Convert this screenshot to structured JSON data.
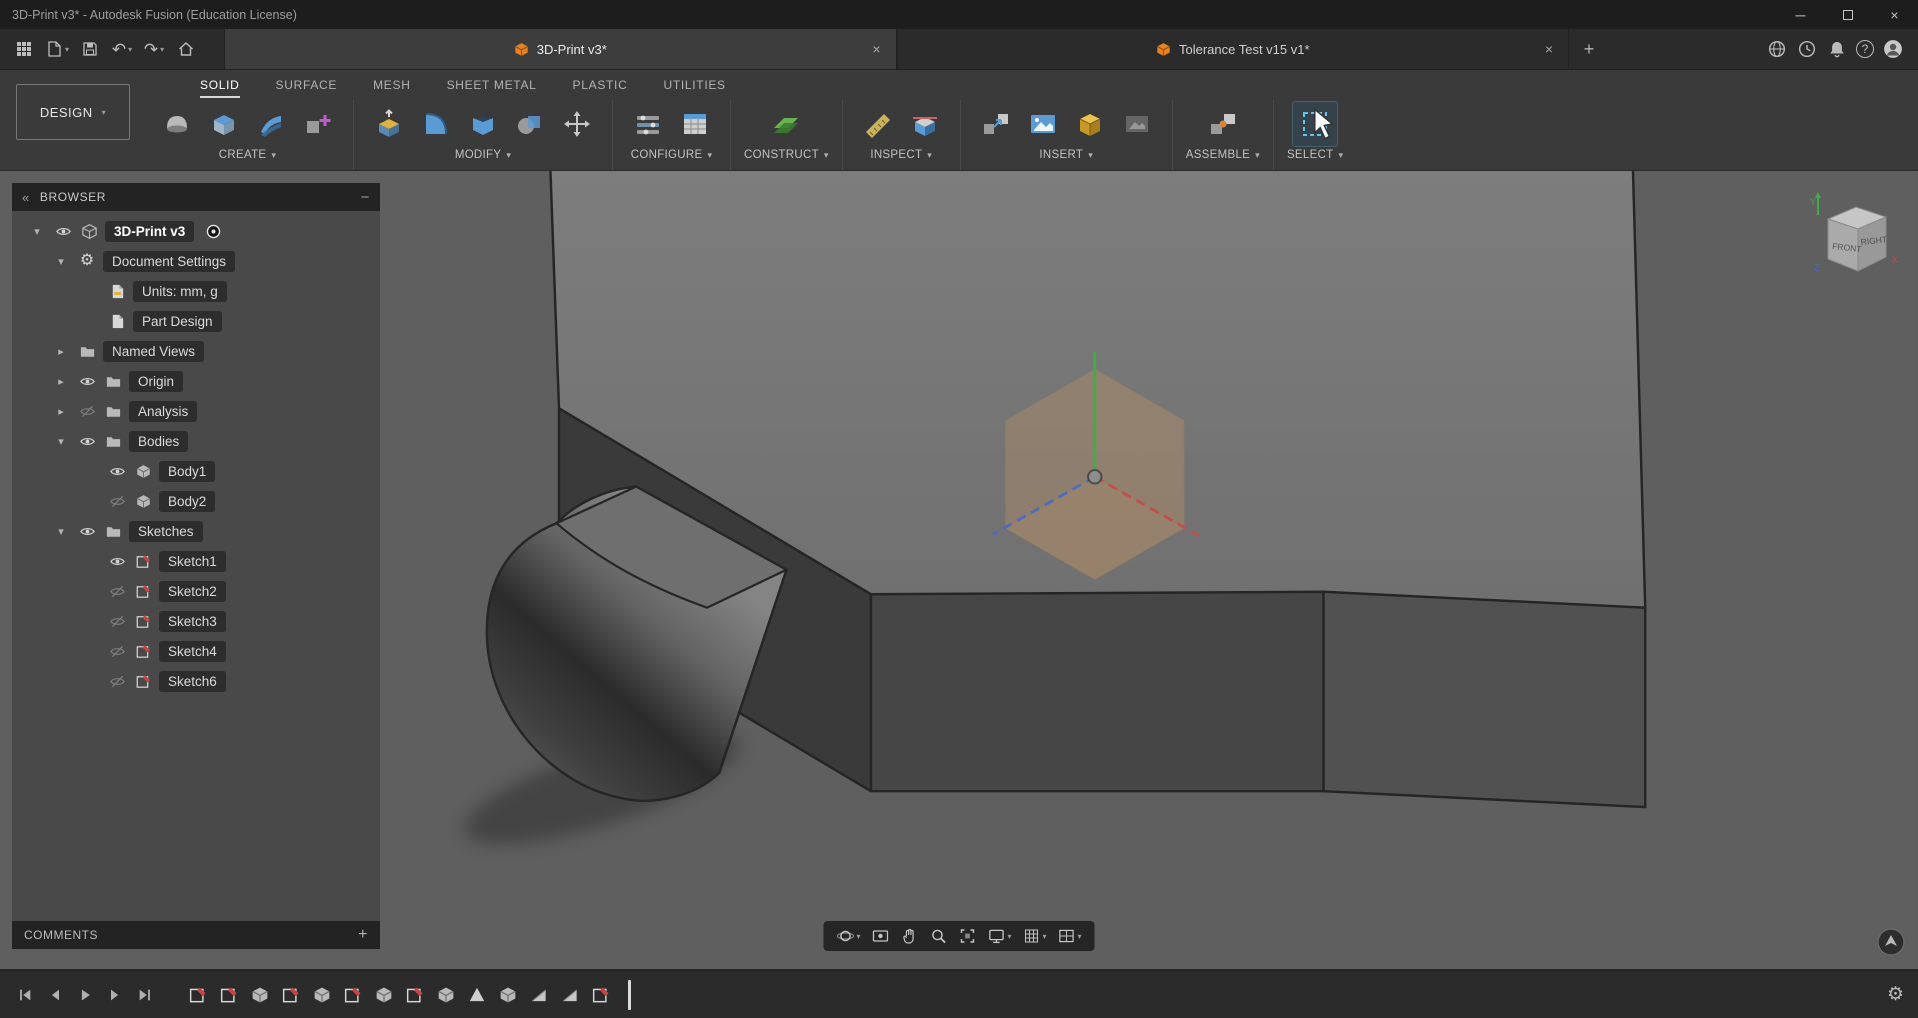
{
  "icons": {
    "close": "×",
    "add": "+",
    "minimize_pane": "−",
    "collapse": "«",
    "window_minimize": "─",
    "window_close": "×",
    "gear": "⚙",
    "undo": "↶",
    "redo": "↷",
    "help": "?"
  },
  "titlebar": {
    "title": "3D-Print v3* - Autodesk Fusion (Education License)"
  },
  "toolbar": {
    "tabs": [
      {
        "label": "3D-Print v3*",
        "active": true
      },
      {
        "label": "Tolerance Test v15 v1*",
        "active": false
      }
    ]
  },
  "ribbon": {
    "workspace": "DESIGN",
    "tabs": [
      {
        "label": "SOLID",
        "active": true
      },
      {
        "label": "SURFACE",
        "active": false
      },
      {
        "label": "MESH",
        "active": false
      },
      {
        "label": "SHEET METAL",
        "active": false
      },
      {
        "label": "PLASTIC",
        "active": false
      },
      {
        "label": "UTILITIES",
        "active": false
      }
    ],
    "groups": [
      {
        "label": "CREATE"
      },
      {
        "label": "MODIFY"
      },
      {
        "label": "CONFIGURE"
      },
      {
        "label": "CONSTRUCT"
      },
      {
        "label": "INSPECT"
      },
      {
        "label": "INSERT"
      },
      {
        "label": "ASSEMBLE"
      },
      {
        "label": "SELECT"
      }
    ]
  },
  "browser": {
    "title": "BROWSER",
    "items": [
      {
        "label": "3D-Print v3",
        "level": 0,
        "caret": "down",
        "eye": "on",
        "icon": "component"
      },
      {
        "label": "Document Settings",
        "level": 1,
        "caret": "down",
        "eye": "none",
        "icon": "gear"
      },
      {
        "label": "Units: mm, g",
        "level": 2,
        "caret": "none",
        "eye": "none",
        "icon": "units"
      },
      {
        "label": "Part Design",
        "level": 2,
        "caret": "none",
        "eye": "none",
        "icon": "document"
      },
      {
        "label": "Named Views",
        "level": 1,
        "caret": "right",
        "eye": "none",
        "icon": "folder"
      },
      {
        "label": "Origin",
        "level": 1,
        "caret": "right",
        "eye": "on",
        "icon": "folder"
      },
      {
        "label": "Analysis",
        "level": 1,
        "caret": "right",
        "eye": "off",
        "icon": "folder"
      },
      {
        "label": "Bodies",
        "level": 1,
        "caret": "down",
        "eye": "on",
        "icon": "folder"
      },
      {
        "label": "Body1",
        "level": 2,
        "caret": "none",
        "eye": "on",
        "icon": "body"
      },
      {
        "label": "Body2",
        "level": 2,
        "caret": "none",
        "eye": "off",
        "icon": "body"
      },
      {
        "label": "Sketches",
        "level": 1,
        "caret": "down",
        "eye": "on",
        "icon": "folder"
      },
      {
        "label": "Sketch1",
        "level": 2,
        "caret": "none",
        "eye": "on",
        "icon": "sketch"
      },
      {
        "label": "Sketch2",
        "level": 2,
        "caret": "none",
        "eye": "off",
        "icon": "sketch"
      },
      {
        "label": "Sketch3",
        "level": 2,
        "caret": "none",
        "eye": "off",
        "icon": "sketch"
      },
      {
        "label": "Sketch4",
        "level": 2,
        "caret": "none",
        "eye": "off",
        "icon": "sketch"
      },
      {
        "label": "Sketch6",
        "level": 2,
        "caret": "none",
        "eye": "off",
        "icon": "sketch"
      }
    ],
    "comments": {
      "label": "COMMENTS"
    }
  },
  "viewcube": {
    "front": "FRONT",
    "right": "RIGHT",
    "x": "X",
    "y": "Y",
    "z": "Z"
  },
  "navbar": {
    "items": [
      "orbit",
      "look-at",
      "pan",
      "zoom",
      "fit",
      "display-settings",
      "grid-and-snaps",
      "viewports"
    ]
  },
  "timeline": {
    "features": [
      "sketch",
      "sketch",
      "extrude",
      "sketch",
      "extrude",
      "sketch",
      "extrude",
      "sketch",
      "extrude",
      "revolve",
      "extrude",
      "chamfer",
      "chamfer",
      "sketch"
    ]
  }
}
